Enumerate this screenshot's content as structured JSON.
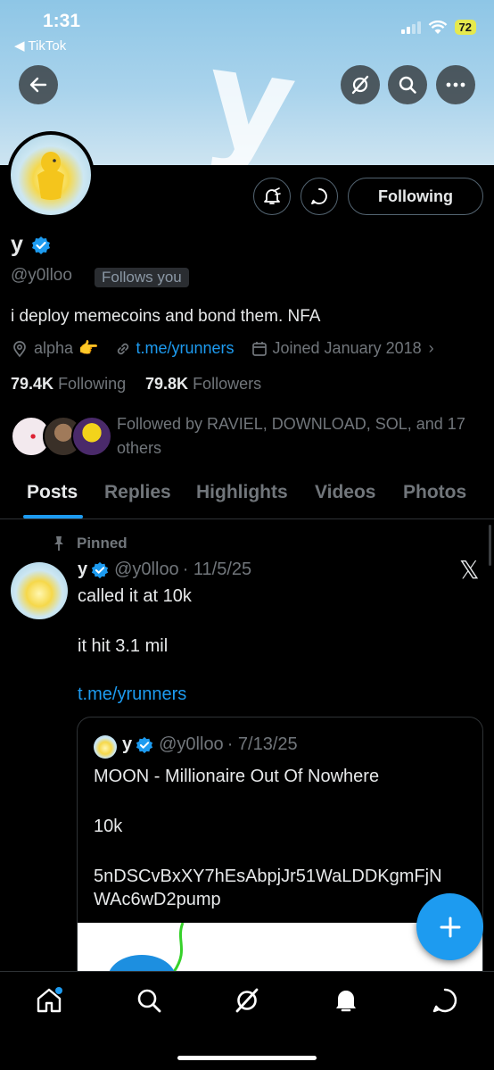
{
  "status_bar": {
    "time": "1:31",
    "back_app": "◀ TikTok",
    "battery": "72"
  },
  "profile": {
    "name": "y",
    "handle": "@y0lloo",
    "follows_you": "Follows you",
    "bio": "i deploy memecoins and bond them. NFA",
    "location": "alpha",
    "location_emoji": "👉",
    "website": "t.me/yrunners",
    "joined": "Joined January 2018",
    "following_count": "79.4K",
    "following_label": "Following",
    "followers_count": "79.8K",
    "followers_label": "Followers",
    "followed_by_line1": "Followed by RAVIEL, DOWNLOAD, SOL, and 17",
    "followed_by_line2": "others",
    "follow_button": "Following"
  },
  "tabs": [
    "Posts",
    "Replies",
    "Highlights",
    "Videos",
    "Photos"
  ],
  "pinned_post": {
    "pinned_label": "Pinned",
    "author_name": "y",
    "author_handle": "@y0lloo",
    "date": "· 11/5/25",
    "line1": "called it at 10k",
    "line2": "it hit 3.1 mil",
    "link": "t.me/yrunners",
    "source_glyph": "𝕏",
    "quote": {
      "author_name": "y",
      "author_handle": "@y0lloo",
      "date": "· 7/13/25",
      "line1": "MOON - Millionaire Out Of Nowhere",
      "line2": "10k",
      "line3": "5nDSCvBxXY7hEsAbpjJr51WaLDDKgmFjN",
      "line4": "WAc6wD2pump"
    }
  },
  "banner_letter": "y",
  "icons": [
    "back-arrow-icon",
    "grok-icon",
    "search-icon",
    "more-icon",
    "notify-bell-icon",
    "message-icon",
    "verified-icon",
    "location-icon",
    "link-icon",
    "calendar-icon",
    "pin-icon",
    "compose-plus-icon",
    "home-icon",
    "explore-icon",
    "grok-nav-icon",
    "notifications-icon",
    "messages-icon"
  ],
  "colors": {
    "accent": "#1d9bf0",
    "background": "#000000",
    "muted": "#71767b",
    "text": "#e7e9ea"
  }
}
